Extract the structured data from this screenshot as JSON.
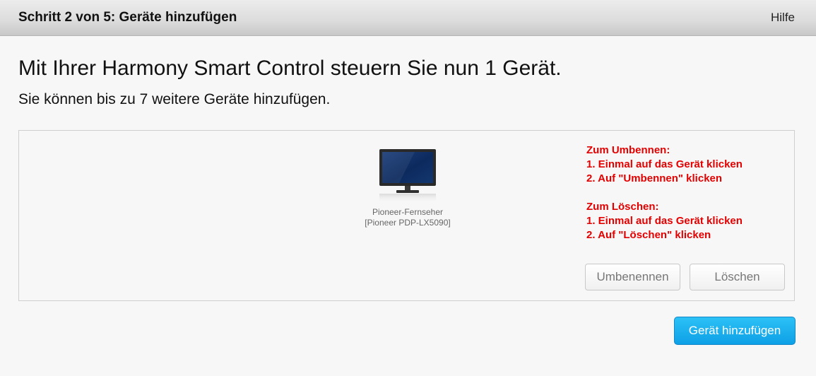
{
  "header": {
    "step_title": "Schritt 2 von 5: Geräte hinzufügen",
    "help_label": "Hilfe"
  },
  "main": {
    "headline": "Mit Ihrer Harmony Smart Control steuern Sie nun 1 Gerät.",
    "subline": "Sie können bis zu 7 weitere Geräte hinzufügen."
  },
  "devices": [
    {
      "icon": "tv-icon",
      "name": "Pioneer-Fernseher",
      "model": "[Pioneer PDP-LX5090]"
    }
  ],
  "instructions": {
    "rename_title": "Zum Umbennen:",
    "rename_step1": "1. Einmal auf das Gerät klicken",
    "rename_step2": "2. Auf \"Umbennen\" klicken",
    "delete_title": "Zum Löschen:",
    "delete_step1": "1. Einmal auf das Gerät klicken",
    "delete_step2": "2. Auf \"Löschen\" klicken",
    "color": "#e30000"
  },
  "buttons": {
    "rename_label": "Umbenennen",
    "delete_label": "Löschen",
    "add_device_label": "Gerät hinzufügen"
  },
  "colors": {
    "primary_button": "#14a8ec",
    "background": "#f7f7f7"
  }
}
